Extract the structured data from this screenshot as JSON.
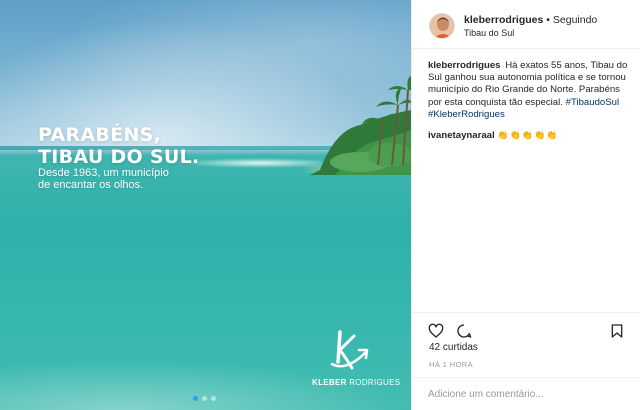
{
  "post_image": {
    "headline_line1": "PARABÉNS,",
    "headline_line2": "TIBAU DO SUL.",
    "subline_line1": "Desde 1963, um município",
    "subline_line2": "de encantar os olhos.",
    "brand_name_bold": "KLEBER",
    "brand_name_rest": " RODRIGUES",
    "carousel": {
      "current": 1,
      "total": 3
    }
  },
  "header": {
    "username": "kleberrodrigues",
    "separator": " • ",
    "follow_status": "Seguindo",
    "location": "Tibau do Sul"
  },
  "caption": {
    "username": "kleberrodrigues",
    "text": "Há exatos 55 anos, Tibau do Sul ganhou sua autonomia política e se tornou município do Rio Grande do Norte. Parabéns por esta conquista tão especial.",
    "hashtags": "#TibaudoSul #KleberRodrigues"
  },
  "comments": [
    {
      "username": "ivanetaynaraal",
      "text": "👏👏👏👏👏"
    }
  ],
  "actions": {
    "icons": [
      "heart-icon",
      "comment-icon",
      "bookmark-icon"
    ]
  },
  "likes": "42 curtidas",
  "time_ago": "HÁ 1 HORA",
  "add_comment": {
    "placeholder": "Adicione um comentário..."
  },
  "colors": {
    "link": "#003569",
    "accent": "#3897f0",
    "border": "#efefef",
    "muted": "#999999"
  }
}
